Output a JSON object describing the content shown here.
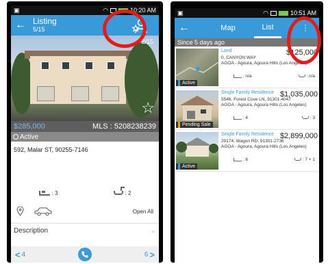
{
  "left_screen": {
    "status": {
      "time": "10:20 AM"
    },
    "header": {
      "title": "Listing",
      "subtitle": "5/15"
    },
    "photo": {
      "counter": "2/15"
    },
    "price": "$285,000",
    "mls": "MLS : 5208238239",
    "status_label": "Active",
    "address": "592, Malar ST, 90255-7146",
    "features": {
      "beds": ": 3",
      "baths": ": 2"
    },
    "open_all": "Open All",
    "description": "Description",
    "nav": {
      "prev": "4",
      "next": "6"
    },
    "colors": {
      "accent": "#3a9ad9",
      "highlight_ring": "#e31b1b"
    }
  },
  "right_screen": {
    "status": {
      "time": "10:51 AM"
    },
    "tabs": [
      {
        "label": "Map"
      },
      {
        "label": "List"
      }
    ],
    "since": "Since 5 days ago",
    "listings": [
      {
        "type": "Land",
        "price": "$125,000",
        "address1": "0, CANYON WAY",
        "address2": "AGOA - Agoura, Agoura Hills (Los Angeles)",
        "beds": ": n/a",
        "baths": ": n/a",
        "tag": "Active",
        "tag_color": "#3a9ad9"
      },
      {
        "type": "Single Family Residence",
        "price": "$1,035,000",
        "address1": "5546, Forest Cove LN, 91301-4047",
        "address2": "AGOA - Agoura, Agoura Hills (Los Angeles)",
        "beds": ": 4",
        "baths": ": 3",
        "tag": "Pending Sale",
        "tag_color": "#f39c12"
      },
      {
        "type": "Single Family Residence",
        "price": "$2,899,000",
        "address1": "29174, Wagon RD, 91301-2736",
        "address2": "AGOA - Agoura, Agoura Hills (Los Angeles)",
        "beds": ": 6",
        "baths": ": 7 + 1",
        "tag": "Active",
        "tag_color": "#3a9ad9"
      }
    ]
  }
}
